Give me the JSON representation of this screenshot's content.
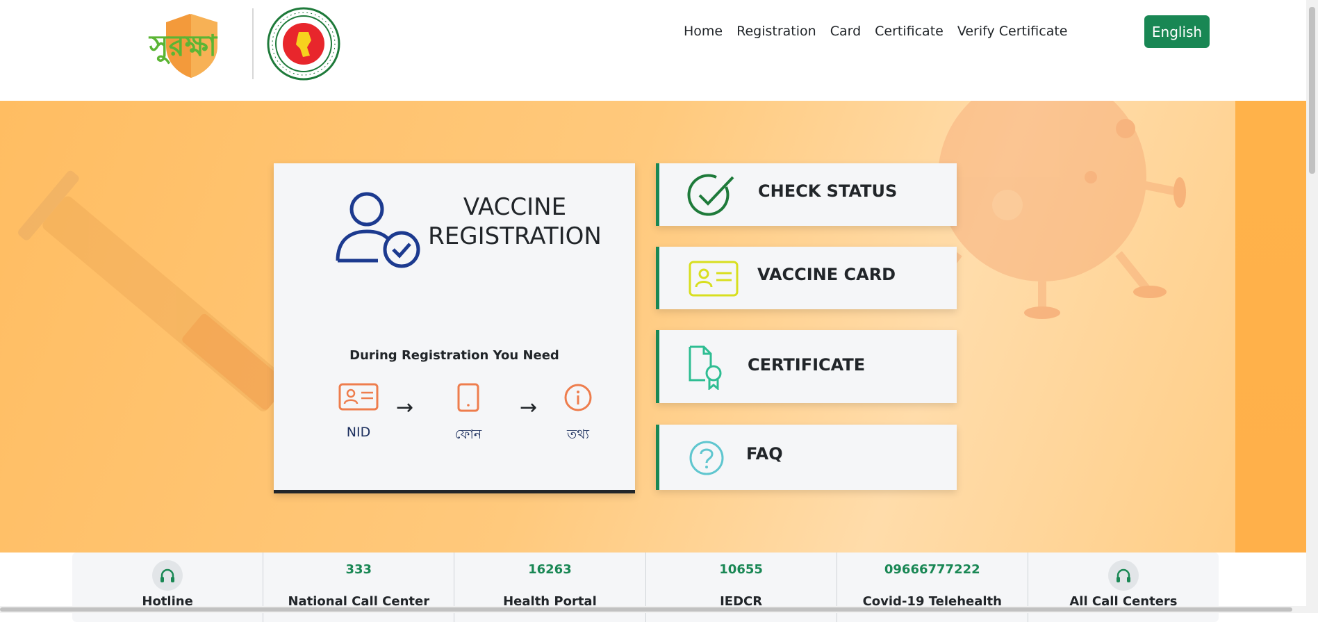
{
  "header": {
    "logo_text": "সুরক্ষা",
    "nav": [
      "Home",
      "Registration",
      "Card",
      "Certificate",
      "Verify Certificate"
    ],
    "language_button": "English"
  },
  "registration_card": {
    "title_line1": "VACCINE",
    "title_line2": "REGISTRATION",
    "need_title": "During Registration You Need",
    "needs": [
      {
        "label": "NID",
        "icon": "id-card-icon"
      },
      {
        "label": "ফোন",
        "icon": "phone-icon"
      },
      {
        "label": "তথ্য",
        "icon": "info-icon"
      }
    ]
  },
  "side_buttons": [
    {
      "label": "CHECK STATUS",
      "icon": "check-circle-icon"
    },
    {
      "label": "VACCINE CARD",
      "icon": "vaccine-card-icon"
    },
    {
      "label": "CERTIFICATE",
      "icon": "certificate-icon"
    },
    {
      "label": "FAQ",
      "icon": "question-icon"
    }
  ],
  "hotlines": [
    {
      "number": "",
      "label": "Hotline",
      "icon": "headset-icon"
    },
    {
      "number": "333",
      "label": "National Call Center"
    },
    {
      "number": "16263",
      "label": "Health Portal"
    },
    {
      "number": "10655",
      "label": "IEDCR"
    },
    {
      "number": "09666777222",
      "label": "Covid-19 Telehealth"
    },
    {
      "number": "",
      "label": "All Call Centers",
      "icon": "headset-icon"
    }
  ],
  "colors": {
    "brand_green": "#198754",
    "hero_orange": "#ffc97c",
    "icon_blue": "#1c3a8f",
    "icon_orange": "#ee7d4d",
    "icon_yellow": "#d8df1f",
    "icon_teal": "#2ebd92",
    "icon_cyan": "#5fc6cf"
  }
}
